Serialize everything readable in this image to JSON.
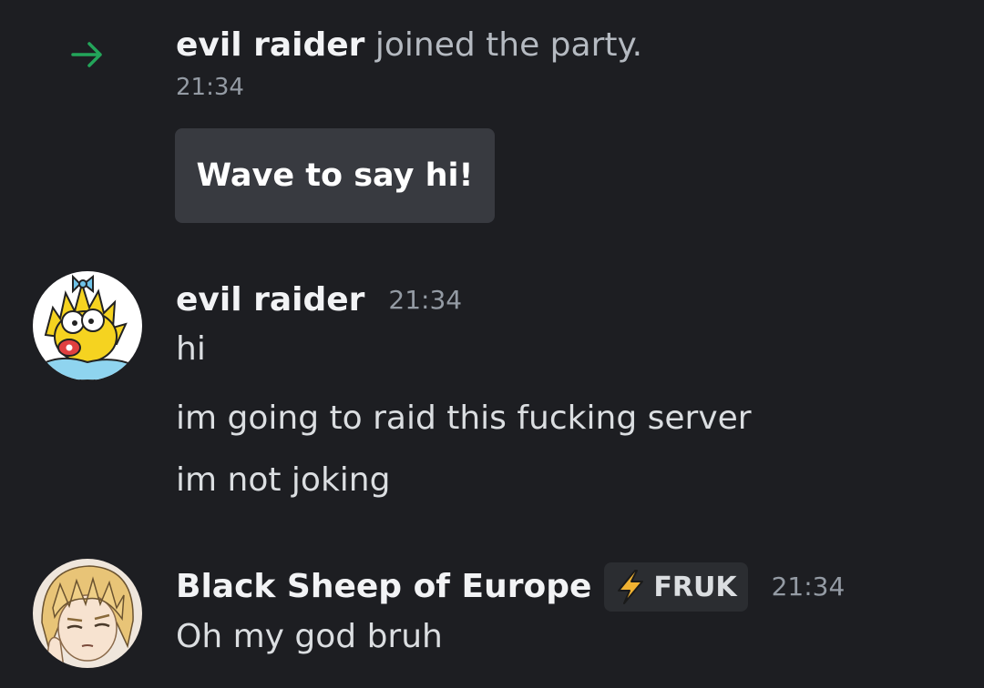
{
  "system": {
    "username": "evil raider",
    "text": " joined the party.",
    "time": "21:34",
    "arrow_icon": "arrow-right-icon",
    "arrow_color": "#23a55a"
  },
  "wave_button": {
    "label": "Wave to say hi!"
  },
  "messages": [
    {
      "username": "evil raider",
      "time": "21:34",
      "avatar_icon": "avatar-cartoon-baby",
      "lines": [
        "hi",
        "im going to raid this fucking server",
        "im not joking"
      ]
    },
    {
      "username": "Black Sheep of Europe",
      "time": "21:34",
      "avatar_icon": "avatar-anime-blonde",
      "tag": {
        "icon": "lightning-icon",
        "label": "FRUK"
      },
      "lines": [
        "Oh my god bruh"
      ]
    }
  ],
  "colors": {
    "background": "#1d1e22",
    "join_arrow": "#23a55a",
    "button_bg": "#383a40",
    "tag_bg": "#2b2d31",
    "tag_icon": "#f0b232"
  }
}
